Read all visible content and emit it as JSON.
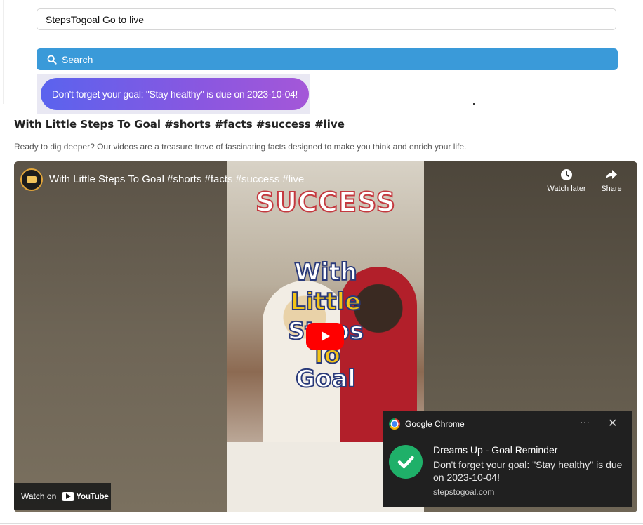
{
  "search": {
    "value": "StepsTogoal Go to live",
    "button_label": "Search"
  },
  "reminder": {
    "text": "Don't forget your goal: \"Stay healthy\" is due on 2023-10-04!"
  },
  "video": {
    "title": "With Little Steps To Goal #shorts #facts #success #live",
    "description": "Ready to dig deeper? Our videos are a treasure trove of fascinating facts designed to make you think and enrich your life.",
    "player": {
      "title": "With Little Steps To Goal #shorts #facts #success #live",
      "watch_later_label": "Watch later",
      "share_label": "Share",
      "watch_on_label": "Watch on",
      "youtube_label": "YouTube",
      "thumbnail_words": [
        "SUCCESS",
        "With",
        "Little",
        "Steps",
        "To",
        "Goal"
      ]
    }
  },
  "notification": {
    "app_name": "Google Chrome",
    "more_label": "···",
    "close_label": "✕",
    "title": "Dreams Up - Goal Reminder",
    "body": "Don't forget your goal: \"Stay healthy\" is due on 2023-10-04!",
    "source": "stepstogoal.com"
  },
  "colors": {
    "search_button": "#3a9ad9",
    "reminder_gradient_start": "#5a63ee",
    "reminder_gradient_end": "#a457d8",
    "play_button": "#ff0000",
    "toast_background": "#202020",
    "check_green": "#1fb069"
  },
  "icons": {
    "search": "search-icon",
    "watch_later": "clock-icon",
    "share": "share-arrow-icon",
    "play": "play-icon",
    "chrome": "chrome-icon",
    "check": "check-icon"
  }
}
